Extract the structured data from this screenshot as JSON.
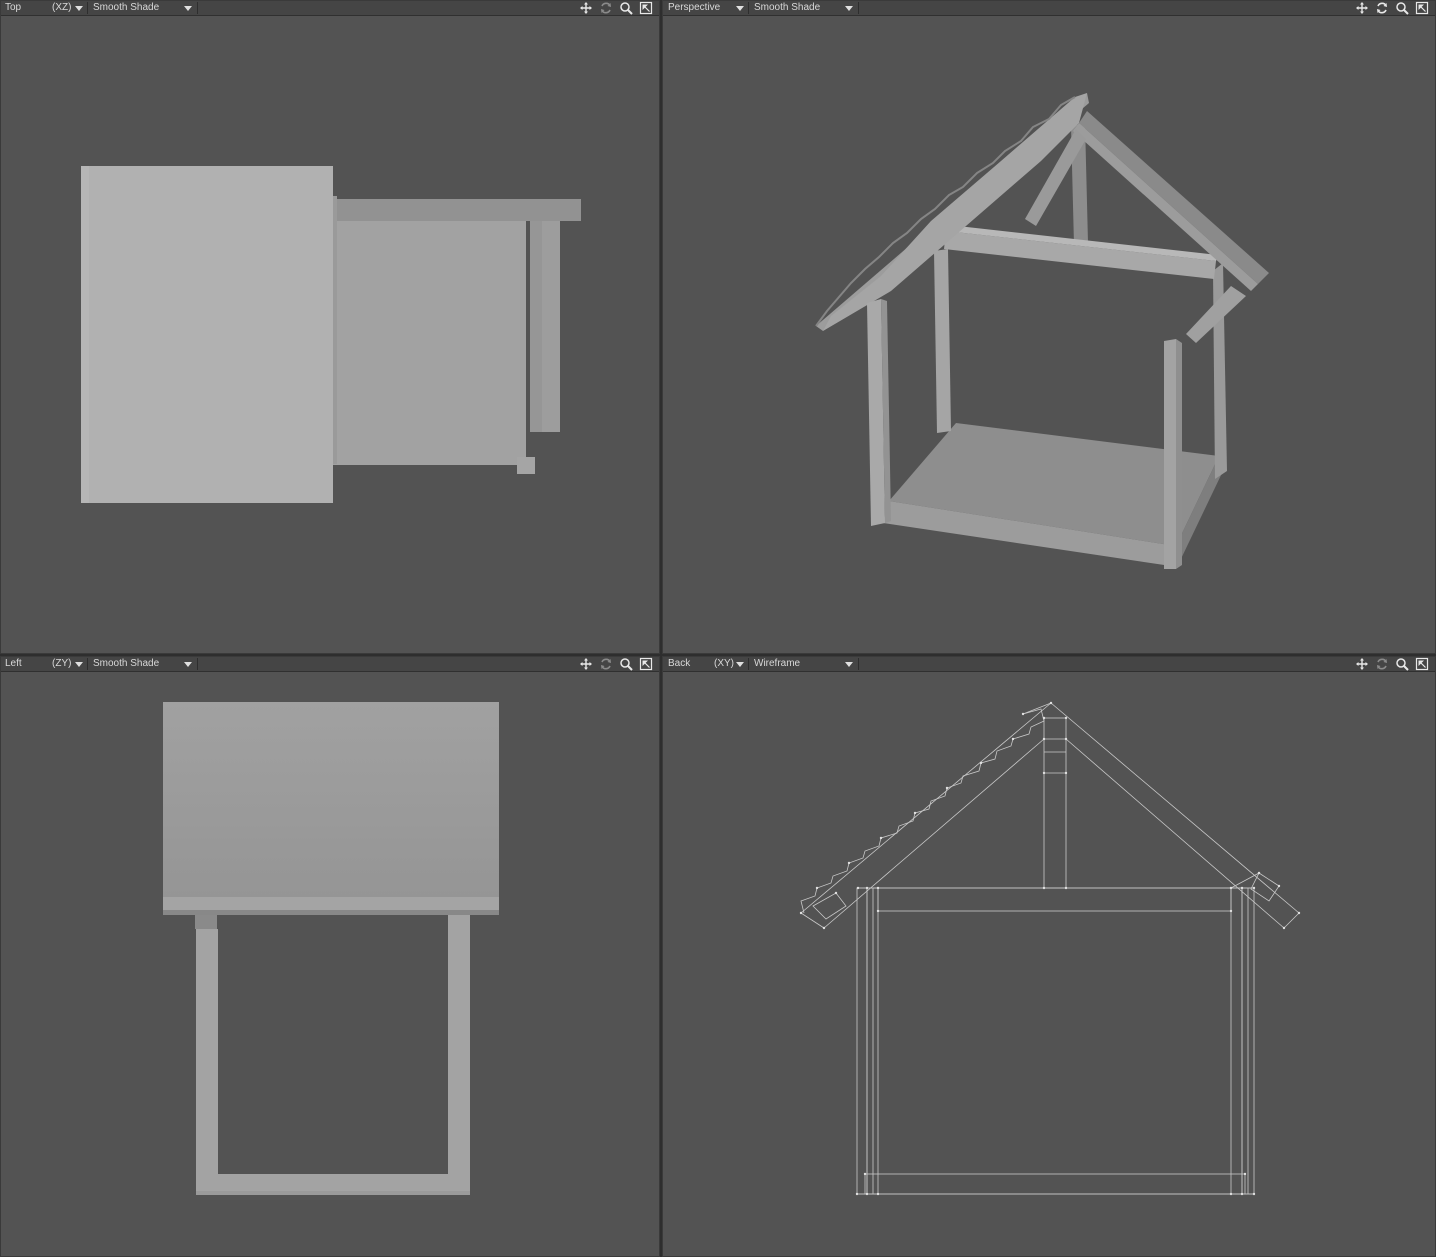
{
  "viewports": {
    "top": {
      "name": "Top",
      "plane": "(XZ)",
      "shading": "Smooth Shade"
    },
    "perspective": {
      "name": "Perspective",
      "shading": "Smooth Shade"
    },
    "left": {
      "name": "Left",
      "plane": "(ZY)",
      "shading": "Smooth Shade"
    },
    "back": {
      "name": "Back",
      "plane": "(XY)",
      "shading": "Wireframe"
    }
  },
  "icons": [
    "move-icon",
    "rotate-icon",
    "zoom-icon",
    "maximize-icon"
  ],
  "colors": {
    "viewport_bg": "#535353",
    "header_bg": "#454545",
    "header_text": "#d8d8d8",
    "model_light": "#b1b1b1",
    "model_mid": "#a0a0a0",
    "model_dark": "#8c8c8c",
    "wireframe": "#c8c8c8"
  }
}
